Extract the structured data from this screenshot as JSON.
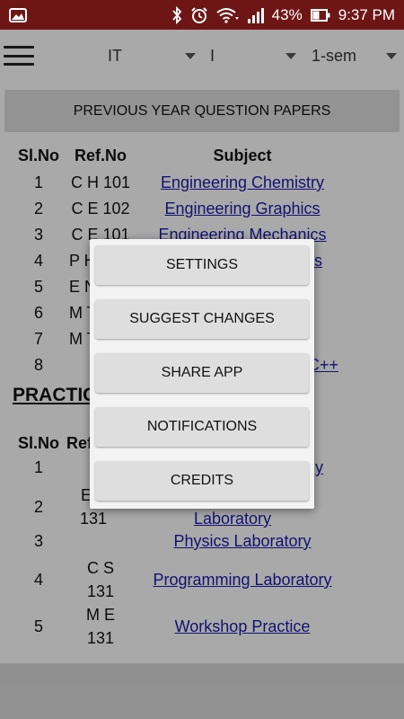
{
  "status_bar": {
    "battery": "43%",
    "time": "9:37 PM",
    "icons": [
      "gallery-icon",
      "bluetooth-icon",
      "alarm-icon",
      "wifi-icon",
      "signal-icon",
      "battery-icon"
    ]
  },
  "toolbar": {
    "branch": "IT",
    "year": "I",
    "semester": "1-sem"
  },
  "banner": {
    "label": "PREVIOUS YEAR QUESTION PAPERS"
  },
  "theory_table": {
    "headers": {
      "slno": "Sl.No",
      "ref": "Ref.No",
      "subject": "Subject"
    },
    "rows": [
      {
        "slno": "1",
        "ref": "C H 101",
        "subject": "Engineering Chemistry"
      },
      {
        "slno": "2",
        "ref": "C E 102",
        "subject": "Engineering Graphics"
      },
      {
        "slno": "3",
        "ref": "C E 101",
        "subject": "Engineering Mechanics"
      },
      {
        "slno": "4",
        "ref": "P H",
        "subject": "s"
      },
      {
        "slno": "5",
        "ref": "E N",
        "subject": ""
      },
      {
        "slno": "6",
        "ref": "M T",
        "subject": ""
      },
      {
        "slno": "7",
        "ref": "M T",
        "subject": ""
      },
      {
        "slno": "8",
        "ref": "",
        "subject": "C++"
      }
    ]
  },
  "practical_section": {
    "title": "PRACTIC",
    "headers": {
      "slno": "Sl.No",
      "ref": "Ref"
    },
    "rows": [
      {
        "slno": "1",
        "ref_line1": "",
        "ref_line2": "",
        "subject_line1": "y",
        "subject_line2": ""
      },
      {
        "slno": "2",
        "ref_line1": "E",
        "ref_line2": "131",
        "subject_line1": "",
        "subject_line2": "Laboratory"
      },
      {
        "slno": "3",
        "ref_line1": "",
        "ref_line2": "",
        "subject_line1": "Physics Laboratory",
        "subject_line2": ""
      },
      {
        "slno": "4",
        "ref_line1": "C S",
        "ref_line2": "131",
        "subject_line1": "Programming Laboratory",
        "subject_line2": ""
      },
      {
        "slno": "5",
        "ref_line1": "M E",
        "ref_line2": "131",
        "subject_line1": "Workshop Practice",
        "subject_line2": ""
      }
    ]
  },
  "menu": {
    "items": [
      {
        "label": "SETTINGS"
      },
      {
        "label": "SUGGEST CHANGES"
      },
      {
        "label": "SHARE APP"
      },
      {
        "label": "NOTIFICATIONS"
      },
      {
        "label": "CREDITS"
      }
    ]
  }
}
